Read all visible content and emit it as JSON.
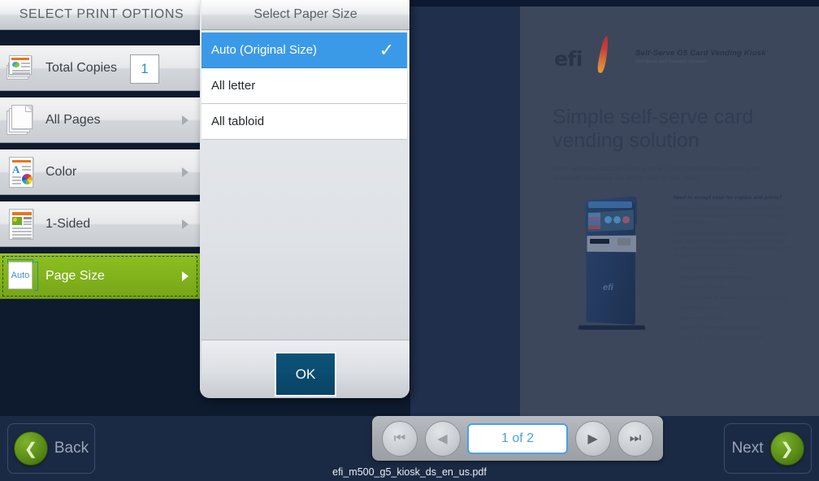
{
  "sidebar": {
    "header": "SELECT PRINT OPTIONS",
    "items": [
      {
        "label": "Total Copies",
        "icon": "copies-icon",
        "value": "1",
        "type": "stepper"
      },
      {
        "label": "All Pages",
        "icon": "pages-icon",
        "type": "submenu"
      },
      {
        "label": "Color",
        "icon": "color-icon",
        "type": "submenu"
      },
      {
        "label": "1-Sided",
        "icon": "sided-icon",
        "type": "submenu"
      },
      {
        "label": "Page Size",
        "icon": "page-size-icon",
        "icon_text": "Auto",
        "type": "submenu",
        "selected": true
      }
    ],
    "accent_green": "#82b31c"
  },
  "panel": {
    "header": "Select Paper Size",
    "options": [
      {
        "label": "Auto (Original Size)",
        "selected": true
      },
      {
        "label": "All letter",
        "selected": false
      },
      {
        "label": "All tabloid",
        "selected": false
      }
    ],
    "ok_label": "OK",
    "selected_color": "#3b9ae8"
  },
  "bottom": {
    "back_label": "Back",
    "next_label": "Next",
    "page_indicator": "1 of 2",
    "filename": "efi_m500_g5_kiosk_ds_en_us.pdf",
    "first_icon": "skip-to-first-icon",
    "prev_icon": "previous-page-icon",
    "next_icon": "next-page-icon",
    "last_icon": "skip-to-last-icon"
  },
  "preview": {
    "logo_text": "efi",
    "logo_title": "Self-Serve G5 Card Vending Kiosk",
    "logo_subtitle": "Self-Serve and Payment Systems",
    "headline": "Simple self-serve card vending solution",
    "subhead": "EFI™ Self-Serve G5 Card Vending Kiosk is a fully featured kiosk enabling the unassisted dispensing and adding value to cash cards.",
    "column_heading": "Need to accept cash for copies and prints?",
    "column_p1": "The G5 Card Vending Kiosk provides a completely self-serve method to accept cash for use with the M500 Copy and Print Station.",
    "column_p2": "By allowing cash customers to dispense and add value to cash cards, check balances and print receipts, it makes accepting cash for copies and prints easy and efficient. The G5 Card Vending Kiosk features:",
    "bullets": [
      "19\" capacitive touch screen",
      "High-speed thermal receipt printing",
      "Capacity for 300 cards",
      "Multi-directional bill acceptor that holds up to 600 bills",
      "2D barcode scanner",
      "Optional coin acceptor",
      "Optional PIN terminal mounting bracket",
      "Support for customized skins and signage"
    ],
    "kiosk_brand": "efi"
  }
}
